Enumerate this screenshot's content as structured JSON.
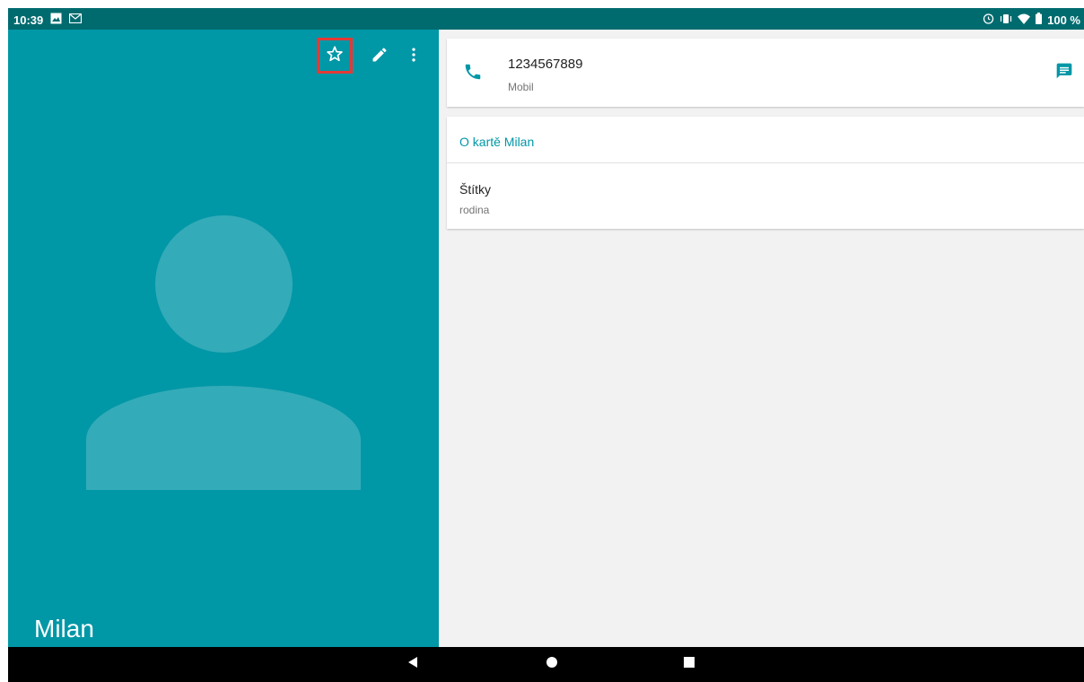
{
  "status_bar": {
    "time": "10:39",
    "battery": "100 %"
  },
  "contact": {
    "name": "Milan"
  },
  "toolbar": {
    "favorite_icon": "star-outline-icon",
    "edit_icon": "pencil-icon",
    "more_icon": "more-vertical-icon"
  },
  "phone": {
    "number": "1234567889",
    "type": "Mobil"
  },
  "about": {
    "title": "O kartě Milan",
    "labels_title": "Štítky",
    "labels_value": "rodina"
  },
  "colors": {
    "accent": "#0097a7",
    "status_bar": "#006b6f",
    "highlight": "#e53935"
  }
}
